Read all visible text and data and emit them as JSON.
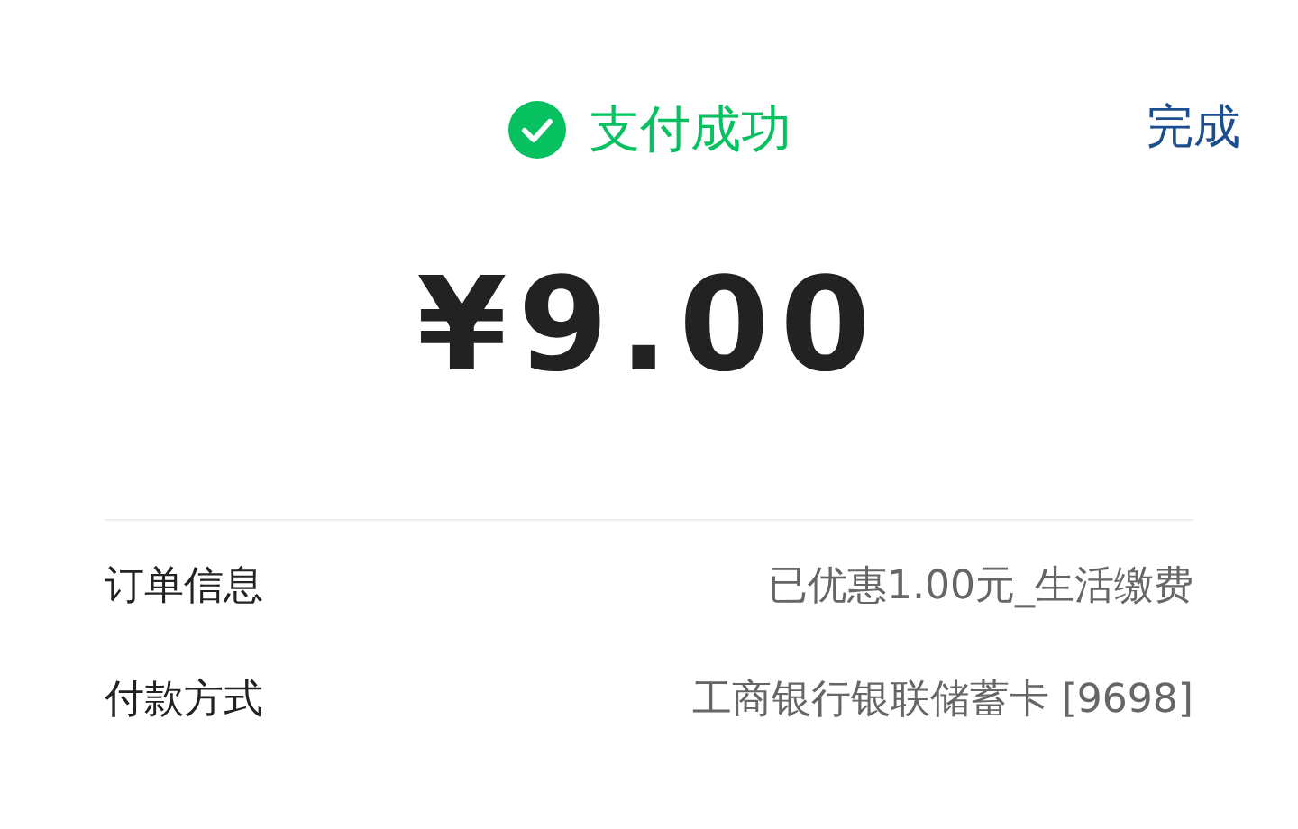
{
  "header": {
    "status": "支付成功",
    "done": "完成"
  },
  "amount": "¥9.00",
  "details": [
    {
      "label": "订单信息",
      "value": "已优惠1.00元_生活缴费"
    },
    {
      "label": "付款方式",
      "value": "工商银行银联储蓄卡 [9698]"
    }
  ]
}
